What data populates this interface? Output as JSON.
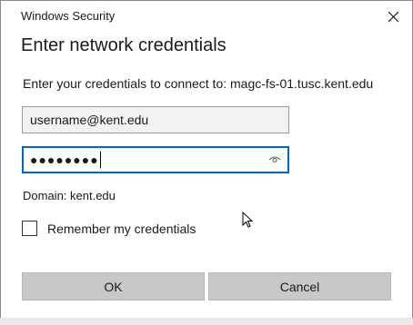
{
  "window": {
    "title": "Windows Security",
    "close_icon": "close-icon"
  },
  "dialog": {
    "heading": "Enter network credentials",
    "prompt": "Enter your credentials to connect to: magc-fs-01.tusc.kent.edu",
    "username": {
      "value": "username@kent.edu"
    },
    "password": {
      "masked_value": "●●●●●●●●",
      "reveal_icon": "eye-icon"
    },
    "domain_text": "Domain: kent.edu",
    "remember": {
      "label": "Remember my credentials",
      "checked": false
    },
    "buttons": {
      "ok": "OK",
      "cancel": "Cancel"
    }
  },
  "colors": {
    "focus_border": "#0067c0",
    "button_bg": "#c8c8c8",
    "field_bg": "#f2f2f2"
  }
}
